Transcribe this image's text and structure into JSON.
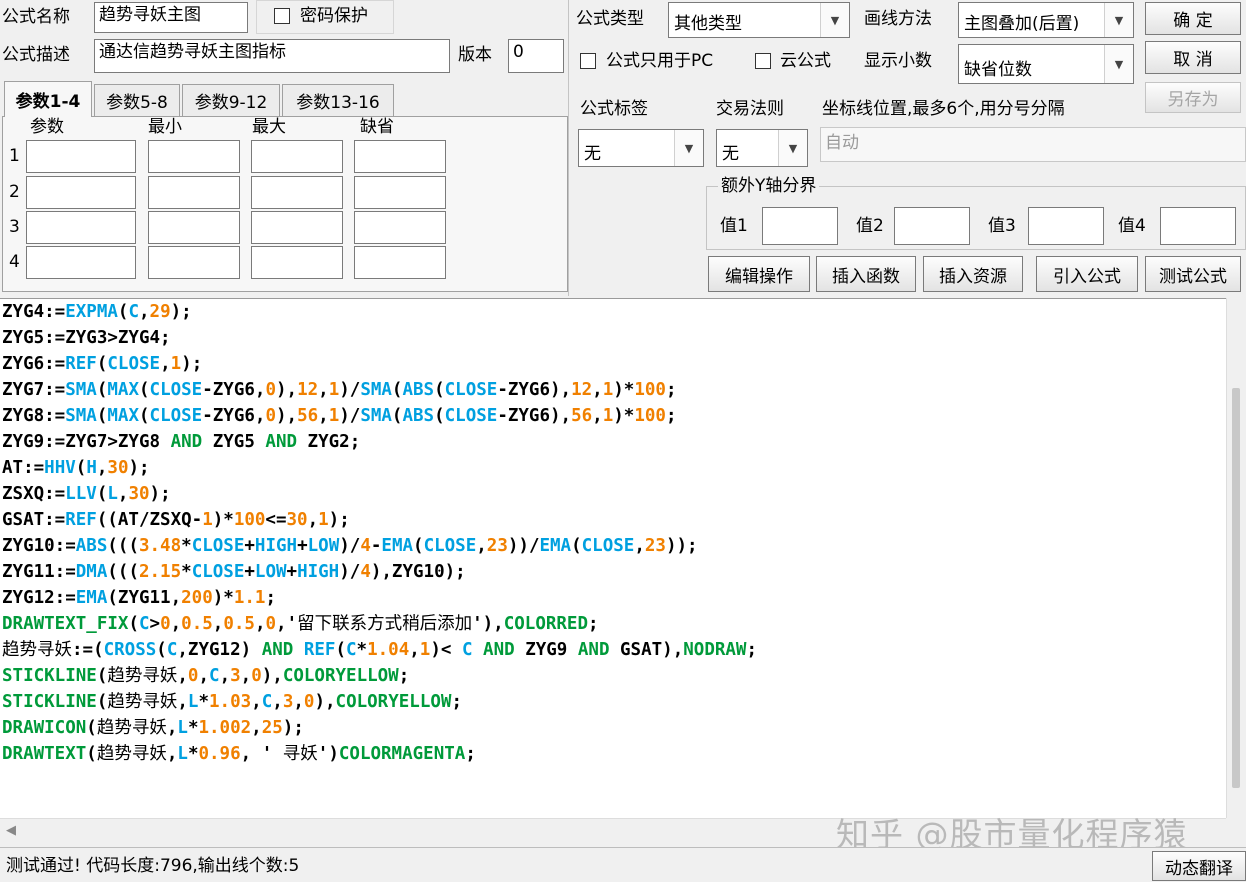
{
  "header": {
    "name_label": "公式名称",
    "name_value": "趋势寻妖主图",
    "password_label": "密码保护",
    "desc_label": "公式描述",
    "desc_value": "通达信趋势寻妖主图指标",
    "version_label": "版本",
    "version_value": "0",
    "type_label": "公式类型",
    "type_value": "其他类型",
    "draw_label": "画线方法",
    "draw_value": "主图叠加(后置)",
    "pc_only_label": "公式只用于PC",
    "cloud_label": "云公式",
    "decimals_label": "显示小数",
    "decimals_value": "缺省位数",
    "tag_label": "公式标签",
    "tag_value": "无",
    "trade_label": "交易法则",
    "trade_value": "无",
    "axis_label": "坐标线位置,最多6个,用分号分隔",
    "axis_placeholder": "自动"
  },
  "buttons": {
    "ok": "确  定",
    "cancel": "取  消",
    "save_as": "另存为",
    "edit": "编辑操作",
    "insert_func": "插入函数",
    "insert_res": "插入资源",
    "import": "引入公式",
    "test": "测试公式",
    "translate": "动态翻译"
  },
  "params": {
    "tabs": [
      "参数1-4",
      "参数5-8",
      "参数9-12",
      "参数13-16"
    ],
    "columns": [
      "参数",
      "最小",
      "最大",
      "缺省"
    ],
    "rows": [
      "1",
      "2",
      "3",
      "4"
    ]
  },
  "yaxis": {
    "title": "额外Y轴分界",
    "labels": [
      "值1",
      "值2",
      "值3",
      "值4"
    ]
  },
  "status": "测试通过! 代码长度:796,输出线个数:5",
  "watermark": "知乎 @股市量化程序猿",
  "code_lines": [
    [
      [
        "ZYG4:=",
        ""
      ],
      [
        "EXPMA",
        "k"
      ],
      [
        "(",
        ""
      ],
      [
        "C",
        "k"
      ],
      [
        ",",
        ""
      ],
      [
        "29",
        "n"
      ],
      [
        ");",
        ""
      ]
    ],
    [
      [
        "ZYG5:=ZYG3>ZYG4;",
        ""
      ]
    ],
    [
      [
        "ZYG6:=",
        ""
      ],
      [
        "REF",
        "k"
      ],
      [
        "(",
        ""
      ],
      [
        "CLOSE",
        "k"
      ],
      [
        ",",
        ""
      ],
      [
        "1",
        "n"
      ],
      [
        ");",
        ""
      ]
    ],
    [
      [
        "ZYG7:=",
        ""
      ],
      [
        "SMA",
        "k"
      ],
      [
        "(",
        ""
      ],
      [
        "MAX",
        "k"
      ],
      [
        "(",
        ""
      ],
      [
        "CLOSE",
        "k"
      ],
      [
        "-ZYG6,",
        ""
      ],
      [
        "0",
        "n"
      ],
      [
        "),",
        ""
      ],
      [
        "12",
        "n"
      ],
      [
        ",",
        ""
      ],
      [
        "1",
        "n"
      ],
      [
        ")/",
        ""
      ],
      [
        "SMA",
        "k"
      ],
      [
        "(",
        ""
      ],
      [
        "ABS",
        "k"
      ],
      [
        "(",
        ""
      ],
      [
        "CLOSE",
        "k"
      ],
      [
        "-ZYG6),",
        ""
      ],
      [
        "12",
        "n"
      ],
      [
        ",",
        ""
      ],
      [
        "1",
        "n"
      ],
      [
        ")*",
        ""
      ],
      [
        "100",
        "n"
      ],
      [
        ";",
        ""
      ]
    ],
    [
      [
        "ZYG8:=",
        ""
      ],
      [
        "SMA",
        "k"
      ],
      [
        "(",
        ""
      ],
      [
        "MAX",
        "k"
      ],
      [
        "(",
        ""
      ],
      [
        "CLOSE",
        "k"
      ],
      [
        "-ZYG6,",
        ""
      ],
      [
        "0",
        "n"
      ],
      [
        "),",
        ""
      ],
      [
        "56",
        "n"
      ],
      [
        ",",
        ""
      ],
      [
        "1",
        "n"
      ],
      [
        ")/",
        ""
      ],
      [
        "SMA",
        "k"
      ],
      [
        "(",
        ""
      ],
      [
        "ABS",
        "k"
      ],
      [
        "(",
        ""
      ],
      [
        "CLOSE",
        "k"
      ],
      [
        "-ZYG6),",
        ""
      ],
      [
        "56",
        "n"
      ],
      [
        ",",
        ""
      ],
      [
        "1",
        "n"
      ],
      [
        ")*",
        ""
      ],
      [
        "100",
        "n"
      ],
      [
        ";",
        ""
      ]
    ],
    [
      [
        "ZYG9:=ZYG7>ZYG8 ",
        ""
      ],
      [
        "AND",
        "g"
      ],
      [
        " ZYG5 ",
        ""
      ],
      [
        "AND",
        "g"
      ],
      [
        " ZYG2;",
        ""
      ]
    ],
    [
      [
        "AT:=",
        ""
      ],
      [
        "HHV",
        "k"
      ],
      [
        "(",
        ""
      ],
      [
        "H",
        "k"
      ],
      [
        ",",
        ""
      ],
      [
        "30",
        "n"
      ],
      [
        ");",
        ""
      ]
    ],
    [
      [
        "ZSXQ:=",
        ""
      ],
      [
        "LLV",
        "k"
      ],
      [
        "(",
        ""
      ],
      [
        "L",
        "k"
      ],
      [
        ",",
        ""
      ],
      [
        "30",
        "n"
      ],
      [
        ");",
        ""
      ]
    ],
    [
      [
        "GSAT:=",
        ""
      ],
      [
        "REF",
        "k"
      ],
      [
        "((AT/ZSXQ-",
        ""
      ],
      [
        "1",
        "n"
      ],
      [
        ")*",
        ""
      ],
      [
        "100",
        "n"
      ],
      [
        "<=",
        ""
      ],
      [
        "30",
        "n"
      ],
      [
        ",",
        ""
      ],
      [
        "1",
        "n"
      ],
      [
        ");",
        ""
      ]
    ],
    [
      [
        "ZYG10:=",
        ""
      ],
      [
        "ABS",
        "k"
      ],
      [
        "(((",
        ""
      ],
      [
        "3.48",
        "n"
      ],
      [
        "*",
        ""
      ],
      [
        "CLOSE",
        "k"
      ],
      [
        "+",
        ""
      ],
      [
        "HIGH",
        "k"
      ],
      [
        "+",
        ""
      ],
      [
        "LOW",
        "k"
      ],
      [
        ")/",
        ""
      ],
      [
        "4",
        "n"
      ],
      [
        "-",
        ""
      ],
      [
        "EMA",
        "k"
      ],
      [
        "(",
        ""
      ],
      [
        "CLOSE",
        "k"
      ],
      [
        ",",
        ""
      ],
      [
        "23",
        "n"
      ],
      [
        "))/",
        ""
      ],
      [
        "EMA",
        "k"
      ],
      [
        "(",
        ""
      ],
      [
        "CLOSE",
        "k"
      ],
      [
        ",",
        ""
      ],
      [
        "23",
        "n"
      ],
      [
        "));",
        ""
      ]
    ],
    [
      [
        "ZYG11:=",
        ""
      ],
      [
        "DMA",
        "k"
      ],
      [
        "(((",
        ""
      ],
      [
        "2.15",
        "n"
      ],
      [
        "*",
        ""
      ],
      [
        "CLOSE",
        "k"
      ],
      [
        "+",
        ""
      ],
      [
        "LOW",
        "k"
      ],
      [
        "+",
        ""
      ],
      [
        "HIGH",
        "k"
      ],
      [
        ")/",
        ""
      ],
      [
        "4",
        "n"
      ],
      [
        "),ZYG10);",
        ""
      ]
    ],
    [
      [
        "ZYG12:=",
        ""
      ],
      [
        "EMA",
        "k"
      ],
      [
        "(ZYG11,",
        ""
      ],
      [
        "200",
        "n"
      ],
      [
        ")*",
        ""
      ],
      [
        "1.1",
        "n"
      ],
      [
        ";",
        ""
      ]
    ],
    [
      [
        "DRAWTEXT_FIX",
        "g"
      ],
      [
        "(",
        ""
      ],
      [
        "C",
        "k"
      ],
      [
        ">",
        ""
      ],
      [
        "0",
        "n"
      ],
      [
        ",",
        ""
      ],
      [
        "0.5",
        "n"
      ],
      [
        ",",
        ""
      ],
      [
        "0.5",
        "n"
      ],
      [
        ",",
        ""
      ],
      [
        "0",
        "n"
      ],
      [
        ",'",
        ""
      ],
      [
        "留下联系方式稍后添加",
        "zh"
      ],
      [
        "'),",
        ""
      ],
      [
        "COLORRED",
        "g"
      ],
      [
        ";",
        ""
      ]
    ],
    [
      [
        "趋势寻妖",
        "zh"
      ],
      [
        ":=(",
        ""
      ],
      [
        "CROSS",
        "k"
      ],
      [
        "(",
        ""
      ],
      [
        "C",
        "k"
      ],
      [
        ",ZYG12) ",
        ""
      ],
      [
        "AND",
        "g"
      ],
      [
        " ",
        ""
      ],
      [
        "REF",
        "k"
      ],
      [
        "(",
        ""
      ],
      [
        "C",
        "k"
      ],
      [
        "*",
        ""
      ],
      [
        "1.04",
        "n"
      ],
      [
        ",",
        ""
      ],
      [
        "1",
        "n"
      ],
      [
        ")< ",
        ""
      ],
      [
        "C",
        "k"
      ],
      [
        " ",
        ""
      ],
      [
        "AND",
        "g"
      ],
      [
        " ZYG9 ",
        ""
      ],
      [
        "AND",
        "g"
      ],
      [
        " GSAT),",
        ""
      ],
      [
        "NODRAW",
        "g"
      ],
      [
        ";",
        ""
      ]
    ],
    [
      [
        "STICKLINE",
        "g"
      ],
      [
        "(",
        ""
      ],
      [
        "趋势寻妖",
        "zh"
      ],
      [
        ",",
        ""
      ],
      [
        "0",
        "n"
      ],
      [
        ",",
        ""
      ],
      [
        "C",
        "k"
      ],
      [
        ",",
        ""
      ],
      [
        "3",
        "n"
      ],
      [
        ",",
        ""
      ],
      [
        "0",
        "n"
      ],
      [
        "),",
        ""
      ],
      [
        "COLORYELLOW",
        "g"
      ],
      [
        ";",
        ""
      ]
    ],
    [
      [
        "STICKLINE",
        "g"
      ],
      [
        "(",
        ""
      ],
      [
        "趋势寻妖",
        "zh"
      ],
      [
        ",",
        ""
      ],
      [
        "L",
        "k"
      ],
      [
        "*",
        ""
      ],
      [
        "1.03",
        "n"
      ],
      [
        ",",
        ""
      ],
      [
        "C",
        "k"
      ],
      [
        ",",
        ""
      ],
      [
        "3",
        "n"
      ],
      [
        ",",
        ""
      ],
      [
        "0",
        "n"
      ],
      [
        "),",
        ""
      ],
      [
        "COLORYELLOW",
        "g"
      ],
      [
        ";",
        ""
      ]
    ],
    [
      [
        "DRAWICON",
        "g"
      ],
      [
        "(",
        ""
      ],
      [
        "趋势寻妖",
        "zh"
      ],
      [
        ",",
        ""
      ],
      [
        "L",
        "k"
      ],
      [
        "*",
        ""
      ],
      [
        "1.002",
        "n"
      ],
      [
        ",",
        ""
      ],
      [
        "25",
        "n"
      ],
      [
        ");",
        ""
      ]
    ],
    [
      [
        "DRAWTEXT",
        "g"
      ],
      [
        "(",
        ""
      ],
      [
        "趋势寻妖",
        "zh"
      ],
      [
        ",",
        ""
      ],
      [
        "L",
        "k"
      ],
      [
        "*",
        ""
      ],
      [
        "0.96",
        "n"
      ],
      [
        ", ' ",
        ""
      ],
      [
        "寻妖",
        "zh"
      ],
      [
        "')",
        ""
      ],
      [
        "COLORMAGENTA",
        "g"
      ],
      [
        ";",
        ""
      ]
    ]
  ]
}
